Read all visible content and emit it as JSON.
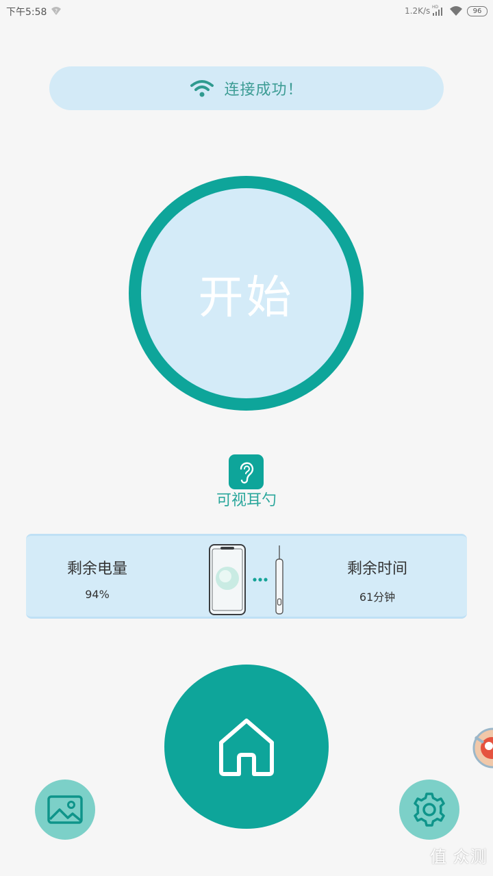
{
  "status_bar": {
    "time": "下午5:58",
    "net_speed": "1.2K/s",
    "battery": "96"
  },
  "connection": {
    "status_text": "连接成功！",
    "icon": "wifi-icon"
  },
  "start_button": {
    "label": "开始"
  },
  "device": {
    "name": "可视耳勺",
    "icon": "ear-icon"
  },
  "info_card": {
    "battery_label": "剩余电量",
    "battery_value": "94%",
    "time_label": "剩余时间",
    "time_value": "61分钟"
  },
  "nav": {
    "home_icon": "home-icon",
    "gallery_icon": "gallery-icon",
    "settings_icon": "gear-icon"
  },
  "watermark": "值 众测",
  "colors": {
    "accent": "#0ea59a",
    "light_blue": "#d4ebf8",
    "soft_teal": "#7cd0c8",
    "text_teal": "#29a69b"
  }
}
